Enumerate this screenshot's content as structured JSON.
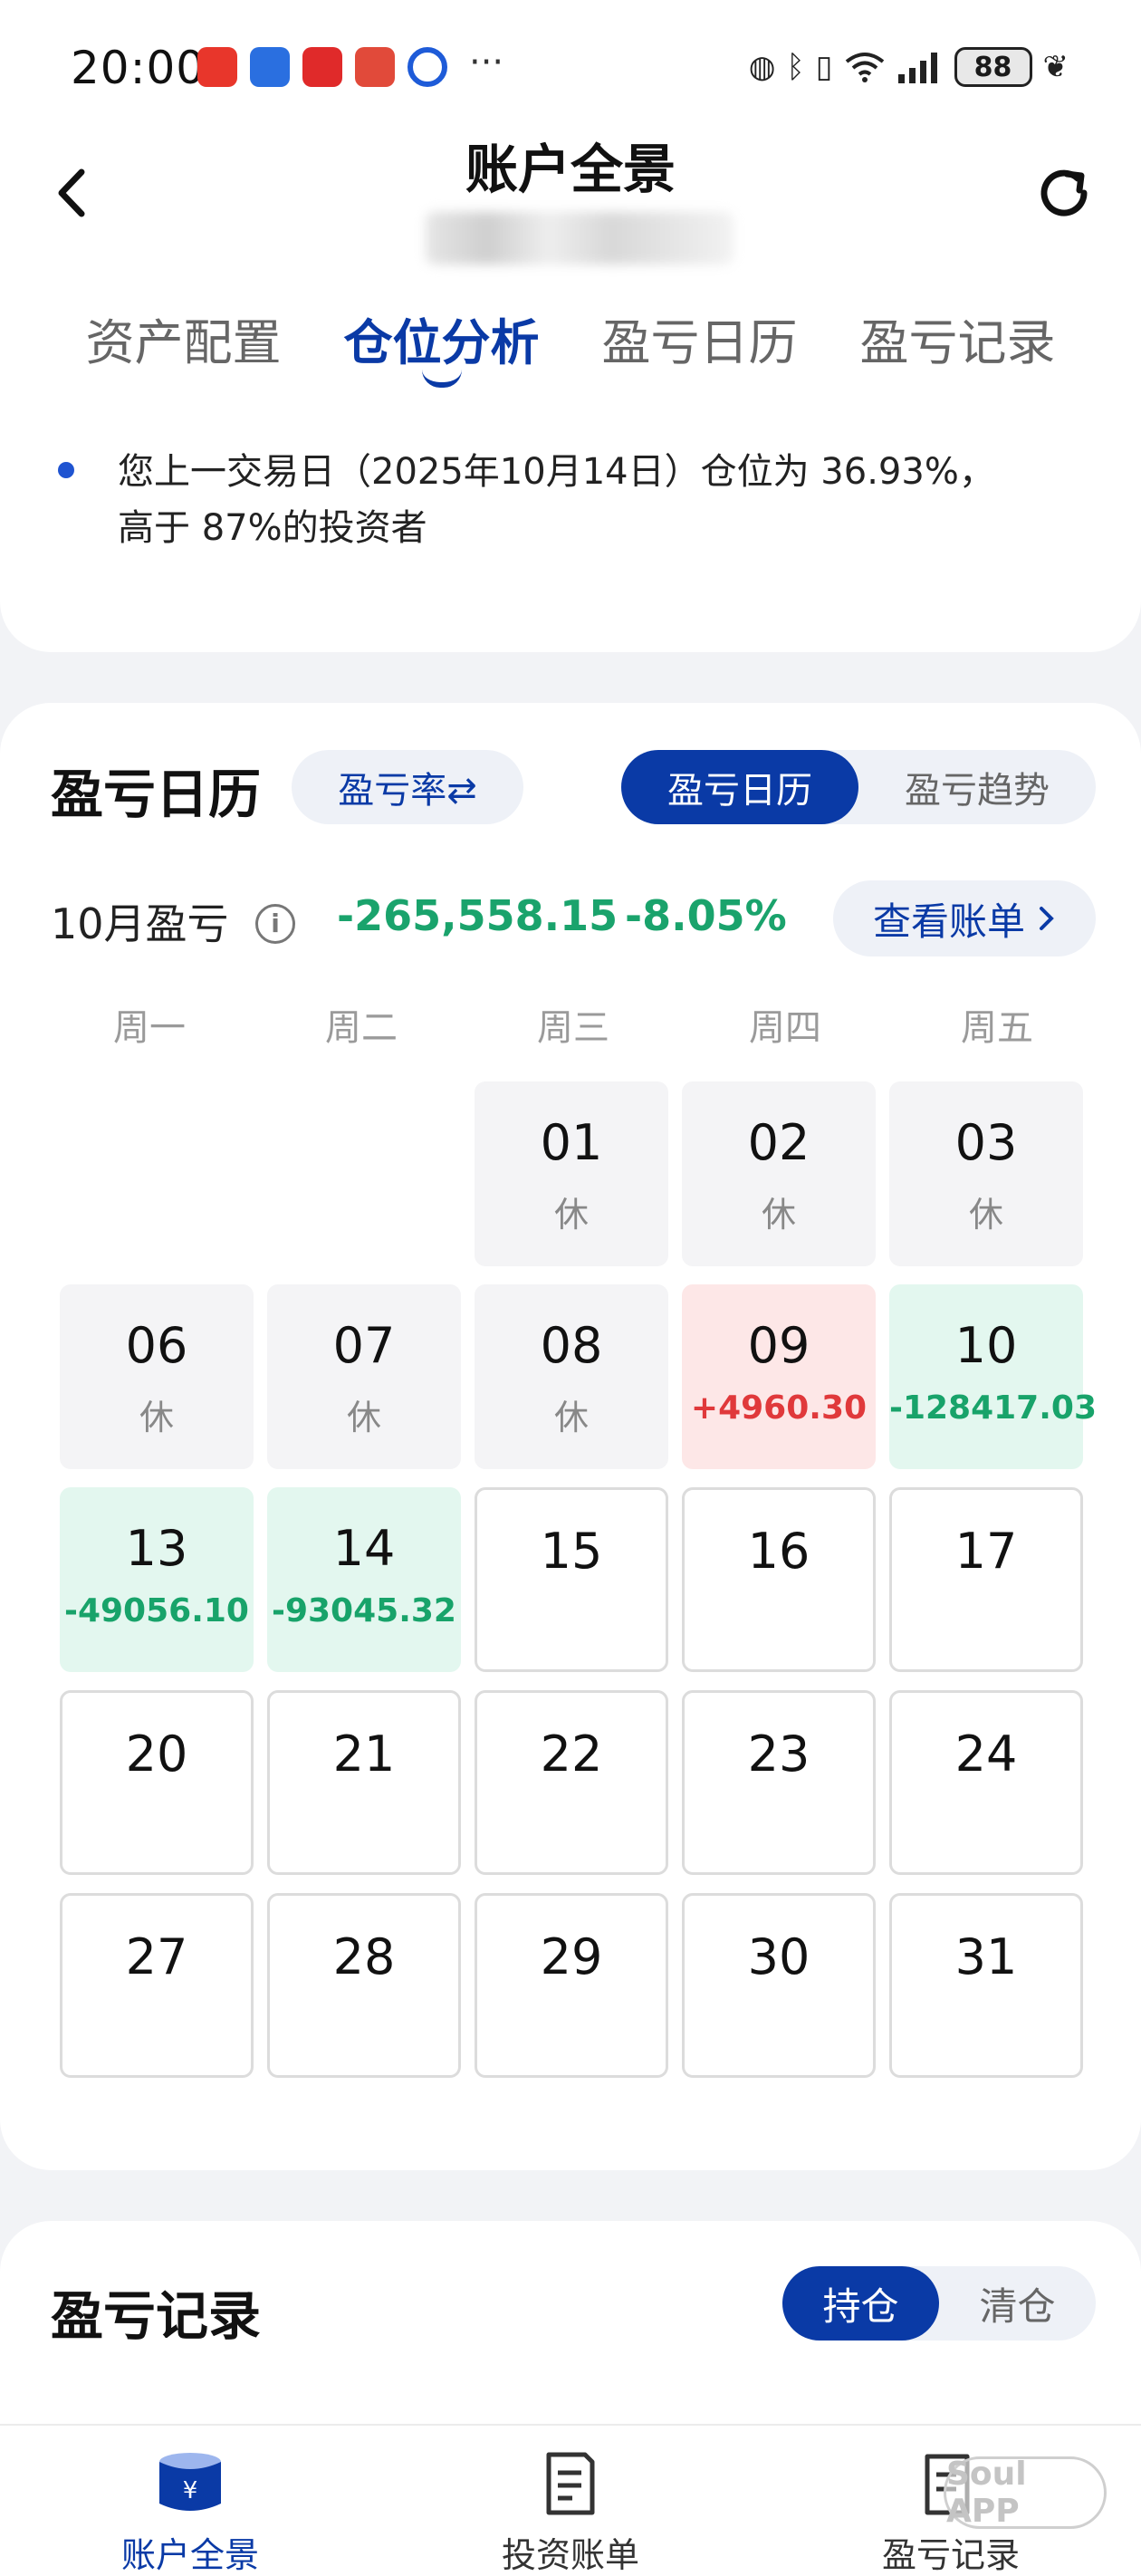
{
  "status": {
    "time": "20:00",
    "more": "···",
    "battery": "88",
    "app_colors": [
      "#e8362b",
      "#2a6fe0",
      "#e02a2a",
      "#e14a3a",
      "#1e5bd8"
    ]
  },
  "header": {
    "title": "账户全景",
    "back_icon": "chevron-left-icon",
    "refresh_icon": "refresh-icon"
  },
  "tabs": [
    {
      "label": "资产配置",
      "active": false
    },
    {
      "label": "仓位分析",
      "active": true
    },
    {
      "label": "盈亏日历",
      "active": false
    },
    {
      "label": "盈亏记录",
      "active": false
    }
  ],
  "note": {
    "line1": "您上一交易日（2025年10月14日）仓位为 36.93%，",
    "line2": "高于 87%的投资者"
  },
  "calendar": {
    "title": "盈亏日历",
    "rate_toggle": "盈亏率⇄",
    "view_options": [
      {
        "label": "盈亏日历",
        "active": true
      },
      {
        "label": "盈亏趋势",
        "active": false
      }
    ],
    "month_label": "10月盈亏",
    "info_icon": "info-icon",
    "month_pl": "-265,558.15",
    "month_pct": "-8.05%",
    "bill_button": "查看账单",
    "weekdays": [
      "周一",
      "周二",
      "周三",
      "周四",
      "周五"
    ],
    "rest_label": "休",
    "cells": [
      {
        "day": "",
        "type": "empty",
        "value": ""
      },
      {
        "day": "",
        "type": "empty",
        "value": ""
      },
      {
        "day": "01",
        "type": "rest",
        "value": "休"
      },
      {
        "day": "02",
        "type": "rest",
        "value": "休"
      },
      {
        "day": "03",
        "type": "rest",
        "value": "休"
      },
      {
        "day": "06",
        "type": "rest",
        "value": "休"
      },
      {
        "day": "07",
        "type": "rest",
        "value": "休"
      },
      {
        "day": "08",
        "type": "rest",
        "value": "休"
      },
      {
        "day": "09",
        "type": "up",
        "value": "+4960.30"
      },
      {
        "day": "10",
        "type": "down",
        "value": "-128417.03"
      },
      {
        "day": "13",
        "type": "down",
        "value": "-49056.10"
      },
      {
        "day": "14",
        "type": "down",
        "value": "-93045.32"
      },
      {
        "day": "15",
        "type": "future",
        "value": ""
      },
      {
        "day": "16",
        "type": "future",
        "value": ""
      },
      {
        "day": "17",
        "type": "future",
        "value": ""
      },
      {
        "day": "20",
        "type": "future",
        "value": ""
      },
      {
        "day": "21",
        "type": "future",
        "value": ""
      },
      {
        "day": "22",
        "type": "future",
        "value": ""
      },
      {
        "day": "23",
        "type": "future",
        "value": ""
      },
      {
        "day": "24",
        "type": "future",
        "value": ""
      },
      {
        "day": "27",
        "type": "future",
        "value": ""
      },
      {
        "day": "28",
        "type": "future",
        "value": ""
      },
      {
        "day": "29",
        "type": "future",
        "value": ""
      },
      {
        "day": "30",
        "type": "future",
        "value": ""
      },
      {
        "day": "31",
        "type": "future",
        "value": ""
      }
    ]
  },
  "records": {
    "title": "盈亏记录",
    "options": [
      {
        "label": "持仓",
        "active": true
      },
      {
        "label": "清仓",
        "active": false
      }
    ]
  },
  "bottom_nav": [
    {
      "label": "账户全景",
      "icon": "wallet-icon",
      "active": true
    },
    {
      "label": "投资账单",
      "icon": "bill-icon",
      "active": false
    },
    {
      "label": "盈亏记录",
      "icon": "record-icon",
      "active": false
    }
  ],
  "watermark": "Soul APP",
  "colors": {
    "brand": "#0a3aa6",
    "profit": "#e0393b",
    "loss": "#18a36a"
  }
}
